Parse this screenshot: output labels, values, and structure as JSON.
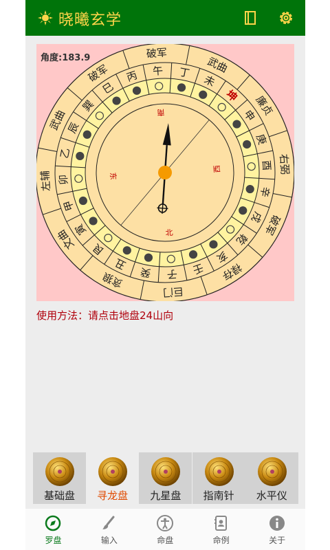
{
  "app": {
    "title": "晓曦玄学"
  },
  "compass": {
    "angle_text": "角度:183.9",
    "outer_ring": [
      "破军",
      "武曲",
      "廉贞",
      "右弼",
      "破军",
      "禄存",
      "巨门",
      "贪狼",
      "文曲",
      "左辅",
      "武曲",
      "破军"
    ],
    "mountains": [
      "丙",
      "午",
      "丁",
      "未",
      "坤",
      "申",
      "庚",
      "酉",
      "辛",
      "戌",
      "乾",
      "亥",
      "壬",
      "子",
      "癸",
      "丑",
      "艮",
      "寅",
      "甲",
      "卯",
      "乙",
      "辰",
      "巽",
      "巳"
    ],
    "highlighted_mountain": "坤",
    "directions": {
      "south": "南",
      "north": "北",
      "east": "东",
      "west": "西"
    }
  },
  "usage_text": "使用方法：请点击地盘24山向",
  "modes": [
    "基础盘",
    "寻龙盘",
    "九星盘",
    "指南针",
    "水平仪"
  ],
  "active_mode": "寻龙盘",
  "tabs": [
    {
      "label": "罗盘",
      "icon": "compass-icon"
    },
    {
      "label": "输入",
      "icon": "brush-icon"
    },
    {
      "label": "命盘",
      "icon": "person-icon"
    },
    {
      "label": "命例",
      "icon": "contacts-book-icon"
    },
    {
      "label": "关于",
      "icon": "info-icon"
    }
  ],
  "colors": {
    "accent": "#00740a",
    "title_yellow": "#ffd54a",
    "dial": "#fde0a4",
    "red": "#c00000",
    "active_tab": "#e04a00"
  }
}
